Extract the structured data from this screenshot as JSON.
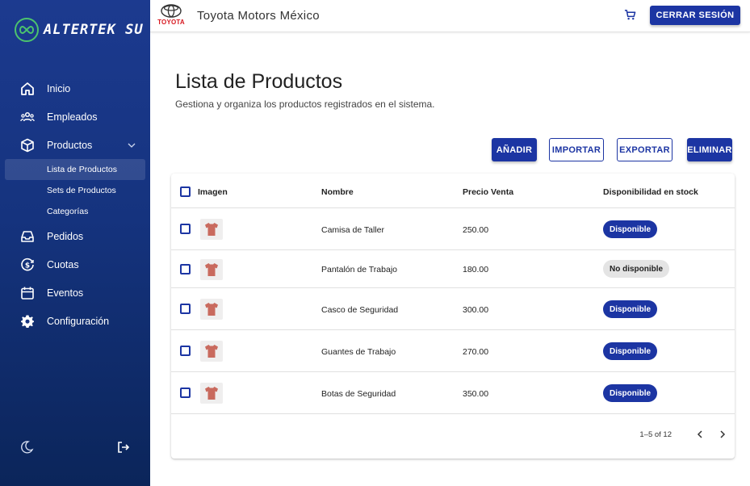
{
  "sidebar": {
    "brand": "ALTERTEK SU",
    "items": [
      {
        "label": "Inicio",
        "icon": "home-icon"
      },
      {
        "label": "Empleados",
        "icon": "people-icon"
      },
      {
        "label": "Productos",
        "icon": "box-icon"
      },
      {
        "label": "Pedidos",
        "icon": "inbox-icon"
      },
      {
        "label": "Cuotas",
        "icon": "dollar-icon"
      },
      {
        "label": "Eventos",
        "icon": "calendar-icon"
      },
      {
        "label": "Configuración",
        "icon": "gear-icon"
      }
    ],
    "subitems": [
      "Lista de Productos",
      "Sets de Productos",
      "Categorías"
    ]
  },
  "header": {
    "logo_word": "TOYOTA",
    "company": "Toyota Motors México",
    "logout_label": "CERRAR SESIÓN"
  },
  "page": {
    "title": "Lista de Productos",
    "subtitle": "Gestiona y organiza los productos registrados en el sistema."
  },
  "actions": {
    "add": "AÑADIR",
    "import": "IMPORTAR",
    "export": "EXPORTAR",
    "delete": "ELIMINAR"
  },
  "table": {
    "headers": {
      "image": "Imagen",
      "name": "Nombre",
      "price": "Precio Venta",
      "stock": "Disponibilidad en stock"
    },
    "rows": [
      {
        "name": "Camisa de Taller",
        "price": "250.00",
        "stock": "Disponible"
      },
      {
        "name": "Pantalón de Trabajo",
        "price": "180.00",
        "stock": "No disponible"
      },
      {
        "name": "Casco de Seguridad",
        "price": "300.00",
        "stock": "Disponible"
      },
      {
        "name": "Guantes de Trabajo",
        "price": "270.00",
        "stock": "Disponible"
      },
      {
        "name": "Botas de Seguridad",
        "price": "350.00",
        "stock": "Disponible"
      }
    ],
    "pagination": "1–5 of 12"
  },
  "colors": {
    "primary": "#1c35a3",
    "sidebar": "#15337e",
    "accent_green": "#4cc36d",
    "shirt": "#c96a5e"
  }
}
